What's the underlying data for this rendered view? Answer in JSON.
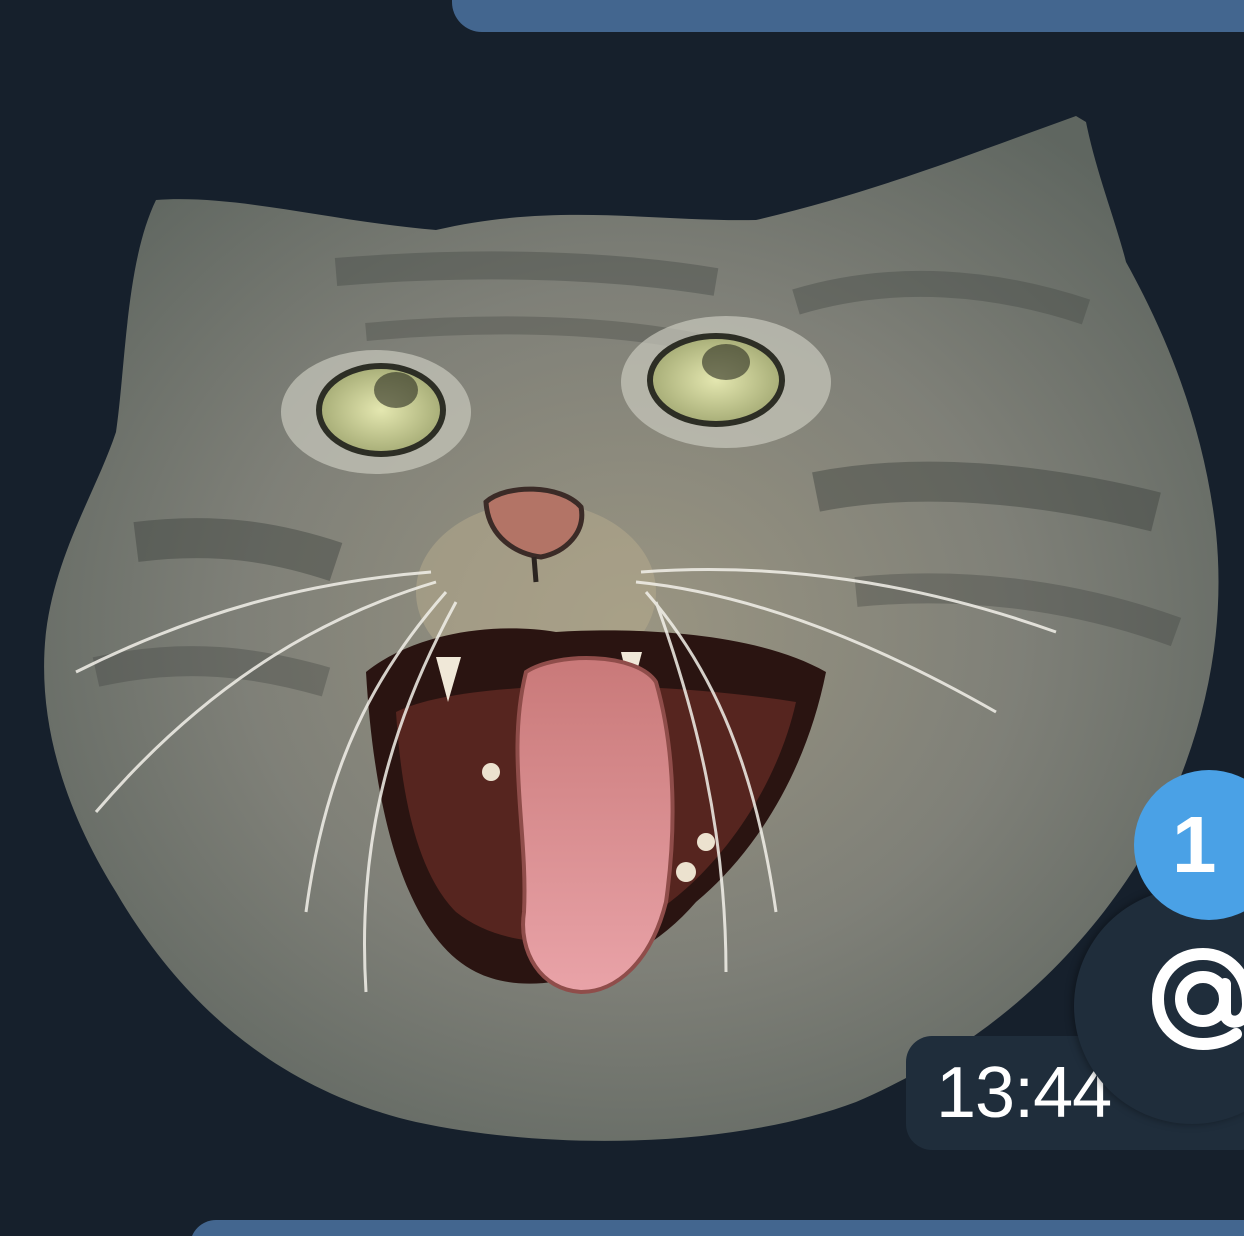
{
  "message": {
    "time": "13:44",
    "sticker": {
      "subject": "cat-face-sticker"
    }
  },
  "mention_button": {
    "icon": "at-sign-icon",
    "unread_count": "1"
  },
  "colors": {
    "background": "#16202c",
    "outgoing_bubble": "#43668f",
    "badge": "#4aa1e6",
    "pill": "#1f2d3b"
  }
}
